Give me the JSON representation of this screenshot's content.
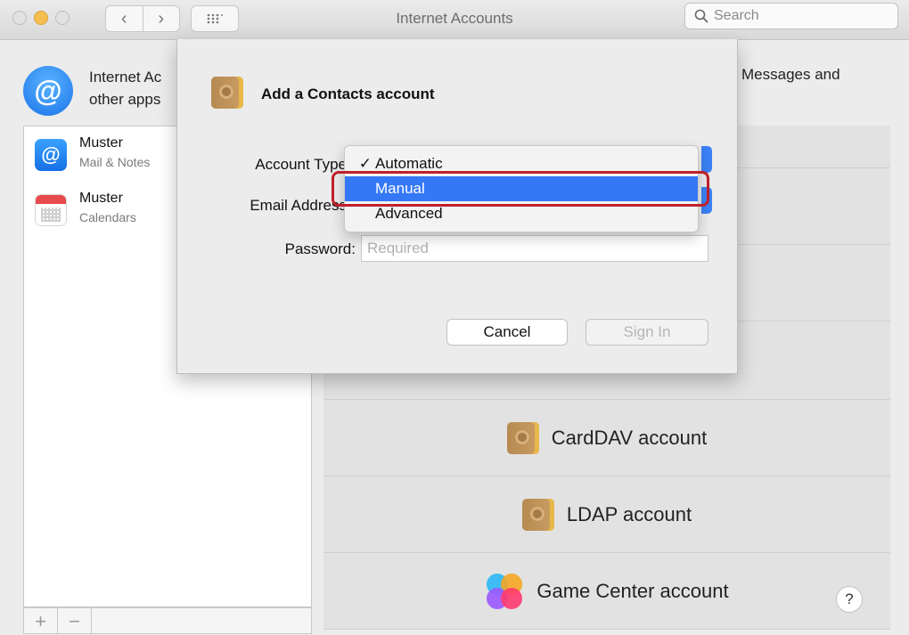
{
  "window": {
    "title": "Internet Accounts"
  },
  "toolbar": {
    "search_placeholder": "Search",
    "back_icon": "chevron-left-icon",
    "forward_icon": "chevron-right-icon",
    "grid_icon": "grid-icon"
  },
  "header": {
    "text_line1": "Internet Ac",
    "text_line2": "other apps",
    "text_right": "Messages and"
  },
  "sidebar": {
    "accounts": [
      {
        "name": "Muster",
        "subtitle": "Mail & Notes",
        "icon": "mail-at-icon"
      },
      {
        "name": "Muster",
        "subtitle": "Calendars",
        "icon": "calendar-icon"
      }
    ],
    "footer": {
      "add": "+",
      "remove": "−"
    }
  },
  "providers": [
    {
      "label": "CardDAV account",
      "icon": "contacts-icon"
    },
    {
      "label": "LDAP account",
      "icon": "contacts-icon"
    },
    {
      "label": "Game Center account",
      "icon": "game-center-icon"
    }
  ],
  "help": "?",
  "sheet": {
    "title": "Add a Contacts account",
    "account_type_label": "Account Type",
    "email_label": "Email Address",
    "password_label": "Password:",
    "password_placeholder": "Required",
    "cancel": "Cancel",
    "sign_in": "Sign In"
  },
  "dropdown": {
    "items": [
      {
        "label": "Automatic",
        "check": "✓"
      },
      {
        "label": "Manual",
        "check": ""
      },
      {
        "label": "Advanced",
        "check": ""
      }
    ],
    "selected_index": 1
  },
  "colors": {
    "accent": "#3478f6",
    "highlight_border": "#c0202a",
    "window_bg": "#ececec"
  }
}
